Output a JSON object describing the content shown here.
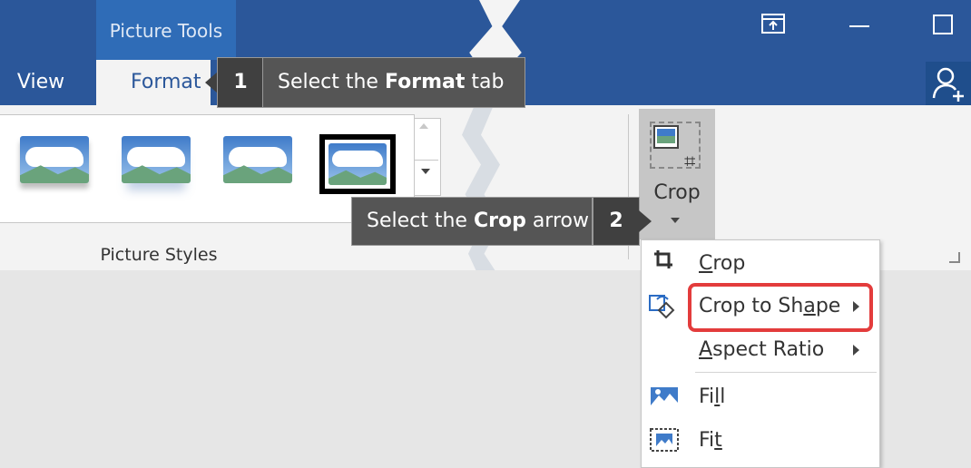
{
  "titlebar": {
    "context_label": "Picture Tools",
    "icons": [
      "restore-icon",
      "minimize-icon",
      "maximize-icon",
      "share-person-icon"
    ]
  },
  "tabs": [
    {
      "label": "View",
      "active": false
    },
    {
      "label": "Format",
      "active": true
    }
  ],
  "gallery": {
    "group_label": "Picture Styles"
  },
  "crop_button": {
    "label": "Crop"
  },
  "callouts": [
    {
      "number": "1",
      "text_before": "Select the ",
      "text_bold": "Format",
      "text_after": " tab"
    },
    {
      "number": "2",
      "text_before": "Select the ",
      "text_bold": "Crop",
      "text_after": " arrow"
    }
  ],
  "crop_menu": {
    "items": [
      {
        "label": "Crop",
        "underline_index": 0,
        "icon": "crop-icon",
        "submenu": false
      },
      {
        "label": "Crop to Shape",
        "underline_index": 10,
        "icon": "crop-to-shape-icon",
        "submenu": true,
        "highlighted": true
      },
      {
        "label": "Aspect Ratio",
        "underline_index": 0,
        "icon": "",
        "submenu": true
      },
      {
        "label": "Fill",
        "underline_index": 2,
        "icon": "fill-icon",
        "submenu": false
      },
      {
        "label": "Fit",
        "underline_index": 2,
        "icon": "fit-icon",
        "submenu": false
      }
    ]
  },
  "colors": {
    "titlebar": "#2b579a",
    "context_band": "#2f6cb7",
    "highlight": "#e33c3c",
    "callout": "#404040"
  }
}
